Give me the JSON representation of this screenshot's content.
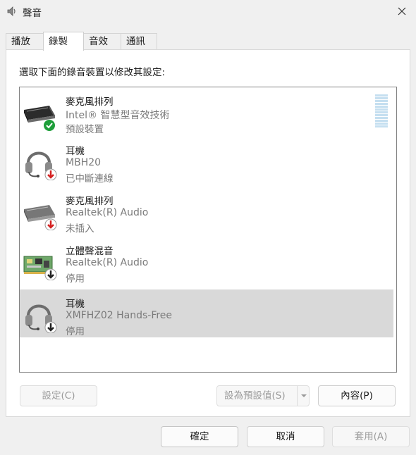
{
  "window": {
    "title": "聲音"
  },
  "tabs": [
    {
      "label": "播放"
    },
    {
      "label": "錄製"
    },
    {
      "label": "音效"
    },
    {
      "label": "通訊"
    }
  ],
  "recording": {
    "instruction": "選取下面的錄音裝置以修改其設定:",
    "devices": [
      {
        "name": "麥克風排列",
        "detail": "Intel® 智慧型音效技術",
        "status": "預設裝置",
        "icon": "mic-array-icon",
        "badge": "default-check-badge",
        "selected": false
      },
      {
        "name": "耳機",
        "detail": "MBH20",
        "status": "已中斷連線",
        "icon": "headset-icon",
        "badge": "disconnected-arrow-badge",
        "selected": false
      },
      {
        "name": "麥克風排列",
        "detail": "Realtek(R) Audio",
        "status": "未插入",
        "icon": "mic-array-icon",
        "badge": "unplugged-arrow-badge",
        "selected": false
      },
      {
        "name": "立體聲混音",
        "detail": "Realtek(R) Audio",
        "status": "停用",
        "icon": "sound-card-icon",
        "badge": "disabled-arrow-badge",
        "selected": false
      },
      {
        "name": "耳機",
        "detail": "XMFHZ02 Hands-Free",
        "status": "停用",
        "icon": "headset-icon",
        "badge": "disabled-arrow-badge",
        "selected": true
      }
    ]
  },
  "buttons": {
    "configure": "設定(C)",
    "set_default": "設為預設值(S)",
    "properties": "內容(P)",
    "ok": "確定",
    "cancel": "取消",
    "apply": "套用(A)"
  },
  "colors": {
    "selection": "#d9d9d9",
    "default_badge": "#1e9e3a",
    "red_badge": "#d32020",
    "level_meter": "#c5dff0"
  }
}
